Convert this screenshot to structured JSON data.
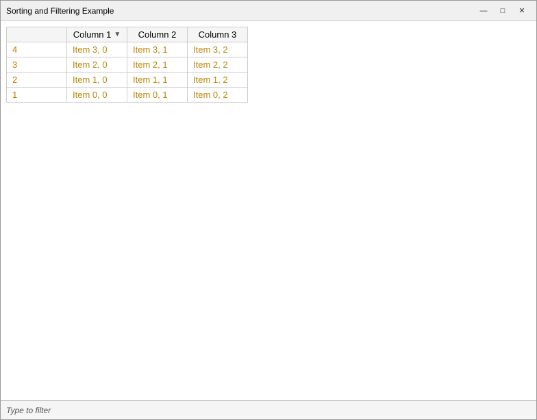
{
  "window": {
    "title": "Sorting and Filtering Example"
  },
  "title_buttons": {
    "minimize": "—",
    "maximize": "□",
    "close": "✕"
  },
  "table": {
    "columns": [
      {
        "id": "num",
        "label": ""
      },
      {
        "id": "col1",
        "label": "Column 1"
      },
      {
        "id": "col2",
        "label": "Column 2"
      },
      {
        "id": "col3",
        "label": "Column 3"
      }
    ],
    "rows": [
      {
        "num": "4",
        "col1": "Item 3, 0",
        "col2": "Item 3, 1",
        "col3": "Item 3, 2"
      },
      {
        "num": "3",
        "col1": "Item 2, 0",
        "col2": "Item 2, 1",
        "col3": "Item 2, 2"
      },
      {
        "num": "2",
        "col1": "Item 1, 0",
        "col2": "Item 1, 1",
        "col3": "Item 1, 2"
      },
      {
        "num": "1",
        "col1": "Item 0, 0",
        "col2": "Item 0, 1",
        "col3": "Item 0, 2"
      }
    ]
  },
  "status_bar": {
    "text": "Type to filter"
  }
}
